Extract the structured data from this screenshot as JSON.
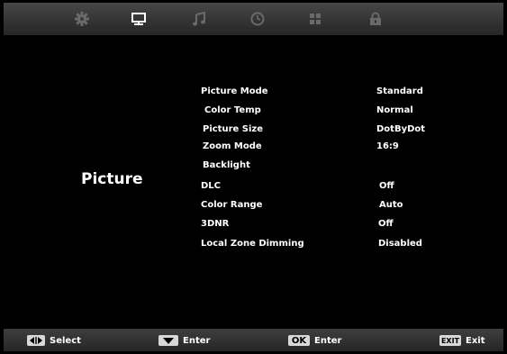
{
  "tabs": [
    {
      "id": "setup",
      "icon": "gear-icon",
      "active": false
    },
    {
      "id": "picture",
      "icon": "monitor-icon",
      "active": true
    },
    {
      "id": "sound",
      "icon": "music-note-icon",
      "active": false
    },
    {
      "id": "time",
      "icon": "clock-icon",
      "active": false
    },
    {
      "id": "apps",
      "icon": "grid-icon",
      "active": false
    },
    {
      "id": "lock",
      "icon": "lock-icon",
      "active": false
    }
  ],
  "section": {
    "title": "Picture"
  },
  "menu": {
    "items": [
      {
        "label": "Picture Mode",
        "value": "Standard"
      },
      {
        "label": "Color Temp",
        "value": "Normal"
      },
      {
        "label": "Picture Size",
        "value": "DotByDot"
      },
      {
        "label": "Zoom Mode",
        "value": "16:9"
      },
      {
        "label": "Backlight",
        "value": ""
      },
      {
        "label": "DLC",
        "value": "Off"
      },
      {
        "label": "Color Range",
        "value": "Auto"
      },
      {
        "label": "3DNR",
        "value": "Off"
      },
      {
        "label": "Local Zone Dimming",
        "value": "Disabled"
      }
    ]
  },
  "footer": {
    "select_label": "Select",
    "enter_label": "Enter",
    "ok_key": "OK",
    "ok_label": "Enter",
    "exit_key": "EXIT",
    "exit_label": "Exit"
  },
  "colors": {
    "background": "#000000",
    "tab_active": "#ffffff",
    "tab_inactive": "#6a6a6a",
    "key_face": "#d8d8d8"
  }
}
